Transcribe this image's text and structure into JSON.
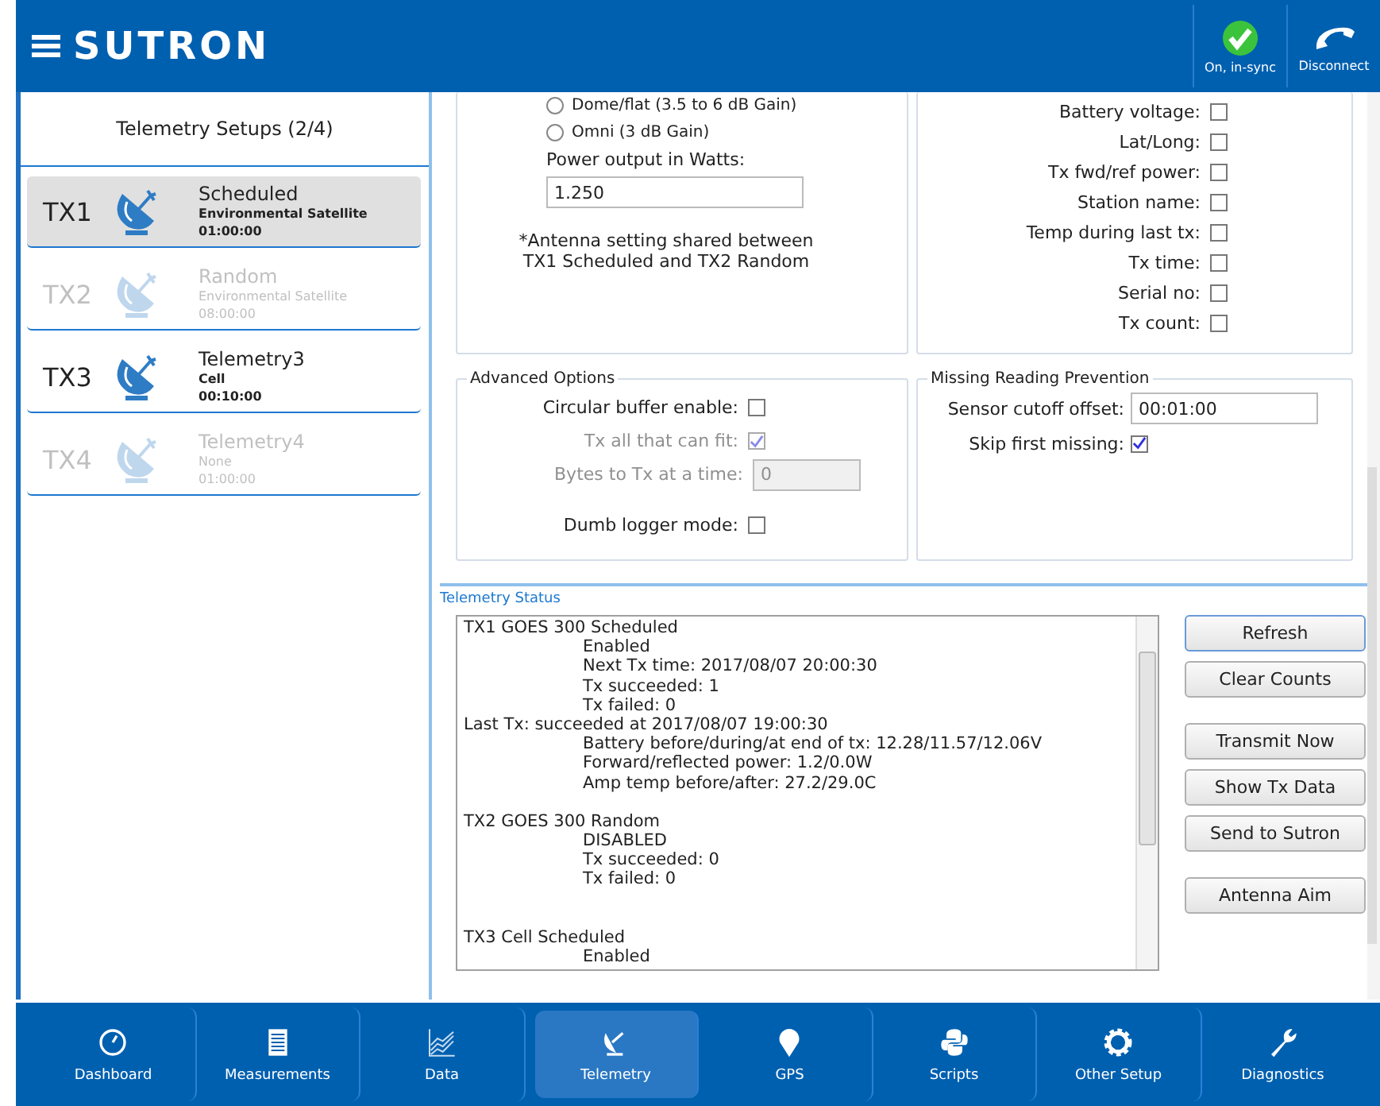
{
  "header": {
    "logo": "SUTRON",
    "status": {
      "label": "On, in-sync"
    },
    "disconnect": {
      "label": "Disconnect"
    }
  },
  "sidebar": {
    "title": "Telemetry Setups (2/4)",
    "items": [
      {
        "id": "TX1",
        "name": "Scheduled",
        "type": "Environmental Satellite",
        "interval": "01:00:00",
        "enabled": true,
        "selected": true
      },
      {
        "id": "TX2",
        "name": "Random",
        "type": "Environmental Satellite",
        "interval": "08:00:00",
        "enabled": false,
        "selected": false
      },
      {
        "id": "TX3",
        "name": "Telemetry3",
        "type": "Cell",
        "interval": "00:10:00",
        "enabled": true,
        "selected": false
      },
      {
        "id": "TX4",
        "name": "Telemetry4",
        "type": "None",
        "interval": "01:00:00",
        "enabled": false,
        "selected": false
      }
    ]
  },
  "antenna": {
    "options": [
      {
        "label": "Dome/flat (3.5 to 6 dB Gain)",
        "selected": false
      },
      {
        "label": "Omni (3 dB Gain)",
        "selected": false
      }
    ],
    "power_label": "Power output in Watts:",
    "power_value": "1.250",
    "note": "*Antenna setting shared between TX1 Scheduled and TX2 Random"
  },
  "append": [
    {
      "label": "Battery voltage:",
      "checked": false
    },
    {
      "label": "Lat/Long:",
      "checked": false
    },
    {
      "label": "Tx fwd/ref power:",
      "checked": false
    },
    {
      "label": "Station name:",
      "checked": false
    },
    {
      "label": "Temp during last tx:",
      "checked": false
    },
    {
      "label": "Tx time:",
      "checked": false
    },
    {
      "label": "Serial no:",
      "checked": false
    },
    {
      "label": "Tx count:",
      "checked": false
    }
  ],
  "advanced": {
    "title": "Advanced Options",
    "rows": [
      {
        "kind": "checkbox",
        "label": "Circular buffer enable:",
        "checked": false,
        "disabled": false
      },
      {
        "kind": "checkbox",
        "label": "Tx all that can fit:",
        "checked": true,
        "disabled": true
      },
      {
        "kind": "field",
        "label": "Bytes to Tx at a time:",
        "value": "0",
        "disabled": true
      },
      {
        "kind": "checkbox",
        "label": "Dumb logger mode:",
        "checked": false,
        "disabled": false
      }
    ]
  },
  "missing": {
    "title": "Missing Reading Prevention",
    "rows": [
      {
        "kind": "field",
        "label": "Sensor cutoff offset:",
        "value": "00:01:00",
        "disabled": false
      },
      {
        "kind": "checkbox",
        "label": "Skip first missing:",
        "checked": true,
        "disabled": false
      }
    ]
  },
  "status": {
    "title": "Telemetry Status",
    "lines": [
      {
        "kind": "heading",
        "text": "TX1 GOES 300 Scheduled"
      },
      {
        "kind": "detail",
        "text": "Enabled"
      },
      {
        "kind": "detail",
        "text": "Next Tx time: 2017/08/07 20:00:30"
      },
      {
        "kind": "detail",
        "text": "Tx succeeded: 1"
      },
      {
        "kind": "detail",
        "text": "Tx failed: 0"
      },
      {
        "kind": "heading",
        "text": "Last Tx: succeeded at 2017/08/07 19:00:30"
      },
      {
        "kind": "detail",
        "text": "Battery before/during/at end of tx: 12.28/11.57/12.06V"
      },
      {
        "kind": "detail",
        "text": "Forward/reflected power: 1.2/0.0W"
      },
      {
        "kind": "detail",
        "text": "Amp temp before/after: 27.2/29.0C"
      },
      {
        "kind": "blank"
      },
      {
        "kind": "heading",
        "text": "TX2 GOES 300 Random"
      },
      {
        "kind": "detail",
        "text": "DISABLED"
      },
      {
        "kind": "detail",
        "text": "Tx succeeded: 0"
      },
      {
        "kind": "detail",
        "text": "Tx failed: 0"
      },
      {
        "kind": "blank"
      },
      {
        "kind": "blank"
      },
      {
        "kind": "heading",
        "text": "TX3 Cell Scheduled"
      },
      {
        "kind": "detail",
        "text": "Enabled"
      }
    ],
    "button_groups": [
      [
        {
          "label": "Refresh",
          "focused": true
        },
        {
          "label": "Clear Counts",
          "focused": false
        }
      ],
      [
        {
          "label": "Transmit Now",
          "focused": false
        },
        {
          "label": "Show Tx Data",
          "focused": false
        },
        {
          "label": "Send to Sutron",
          "focused": false
        }
      ],
      [
        {
          "label": "Antenna Aim",
          "focused": false
        }
      ]
    ]
  },
  "nav": [
    {
      "label": "Dashboard",
      "selected": false
    },
    {
      "label": "Measurements",
      "selected": false
    },
    {
      "label": "Data",
      "selected": false
    },
    {
      "label": "Telemetry",
      "selected": true
    },
    {
      "label": "GPS",
      "selected": false
    },
    {
      "label": "Scripts",
      "selected": false
    },
    {
      "label": "Other Setup",
      "selected": false
    },
    {
      "label": "Diagnostics",
      "selected": false
    }
  ]
}
